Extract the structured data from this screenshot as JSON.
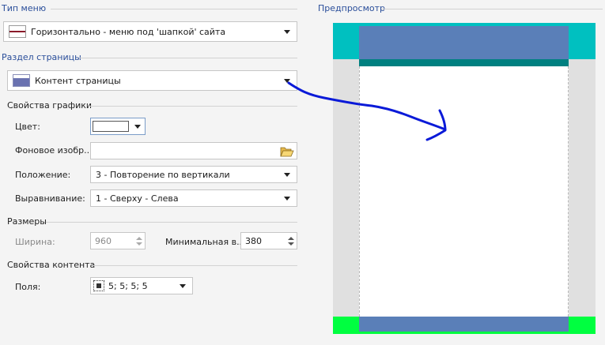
{
  "menu_type": {
    "title": "Тип меню",
    "selected": "Горизонтально - меню под 'шапкой' сайта",
    "icon": "menu-layout-icon"
  },
  "page_section": {
    "title": "Раздел страницы",
    "selected": "Контент страницы",
    "icon": "content-layout-icon"
  },
  "graphics": {
    "title": "Свойства графики",
    "color_label": "Цвет:",
    "color_value": "#ffffff",
    "bg_image_label": "Фоновое изобр...",
    "bg_image_value": "",
    "position_label": "Положение:",
    "position_value": "3 - Повторение по вертикали",
    "align_label": "Выравнивание:",
    "align_value": "1 - Сверху - Слева"
  },
  "sizes": {
    "title": "Размеры",
    "width_label": "Ширина:",
    "width_value": "960",
    "min_height_label": "Минимальная в...",
    "min_height_value": "380"
  },
  "content_props": {
    "title": "Свойства контента",
    "padding_label": "Поля:",
    "padding_value": "5; 5; 5; 5"
  },
  "preview": {
    "title": "Предпросмотр",
    "colors": {
      "header_bg": "#00c0c0",
      "header_inner": "#5a7fb8",
      "menu_bar": "#008080",
      "side_bg": "#e0e0e0",
      "content_bg": "#ffffff",
      "footer_bg": "#00ff40",
      "footer_inner": "#5a7fb8",
      "annotation_stroke": "#0a1ad8"
    }
  }
}
